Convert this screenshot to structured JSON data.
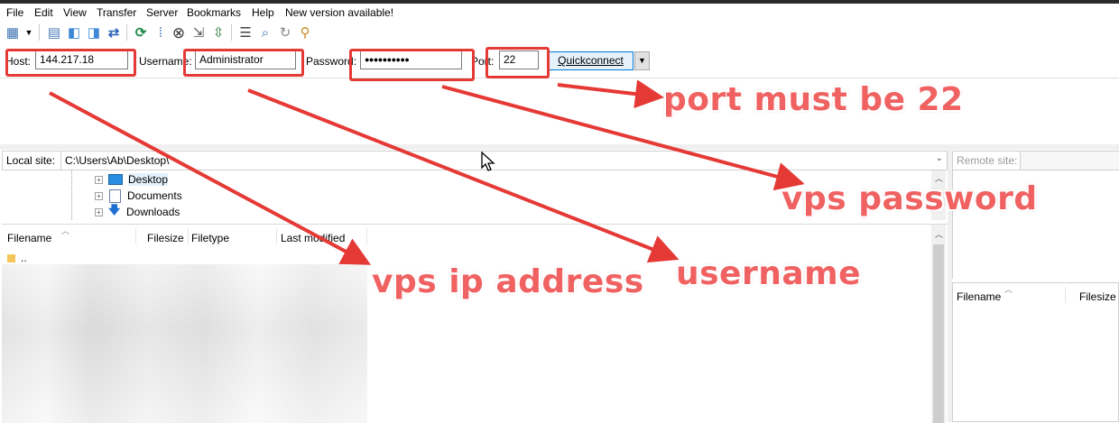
{
  "menubar": {
    "items": [
      "File",
      "Edit",
      "View",
      "Transfer",
      "Server",
      "Bookmarks",
      "Help",
      "New version available!"
    ]
  },
  "toolbar": {
    "icons": [
      "site-manager-icon",
      "dropdown-arrow-icon",
      "message-log-icon",
      "local-tree-icon",
      "remote-tree-icon",
      "transfer-queue-icon",
      "refresh-icon",
      "process-queue-icon",
      "cancel-icon",
      "disconnect-icon",
      "reconnect-icon",
      "filter-icon",
      "compare-icon",
      "sync-browse-icon",
      "search-icon"
    ]
  },
  "quickconnect": {
    "host_label": "Host:",
    "host_value": "144.217.18",
    "username_label": "Username:",
    "username_value": "Administrator",
    "password_label": "Password:",
    "password_value": "●●●●●●●●●●",
    "port_label": "Port:",
    "port_value": "22",
    "connect_label": "Quickconnect",
    "dropdown_glyph": "▼"
  },
  "local": {
    "site_label": "Local site:",
    "site_path": "C:\\Users\\Ab\\Desktop\\",
    "tree": [
      "Desktop",
      "Documents",
      "Downloads"
    ],
    "columns": [
      "Filename",
      "Filesize",
      "Filetype",
      "Last modified"
    ],
    "parent_entry": ".."
  },
  "remote": {
    "site_label": "Remote site:",
    "columns": [
      "Filename",
      "Filesize"
    ]
  },
  "annotations": {
    "port": "port must be 22",
    "password": "vps password",
    "ip": "vps ip address",
    "username": "username"
  },
  "colors": {
    "annotation": "#e53935",
    "annotation_text": "#f06262"
  }
}
